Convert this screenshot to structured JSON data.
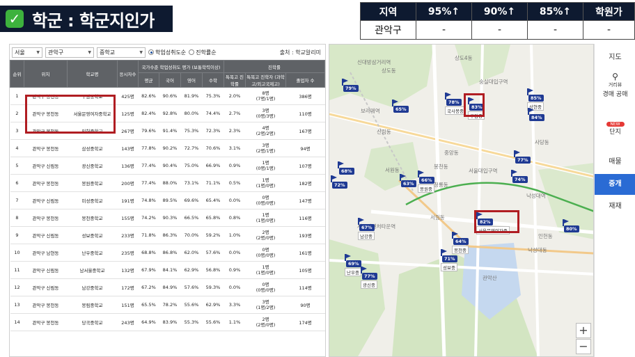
{
  "header": {
    "check_icon": "✓",
    "title": "학군 : 학군지인가"
  },
  "stats": {
    "headers": [
      "지역",
      "95%↑",
      "90%↑",
      "85%↑",
      "학원가"
    ],
    "row": [
      "관악구",
      "-",
      "-",
      "-",
      "-"
    ]
  },
  "filters": {
    "city": "서울",
    "district": "관악구",
    "school_type": "중학교",
    "radio_1": "학업성취도순",
    "radio_2": "진학률순",
    "source": "출처 : 학교알리미"
  },
  "table": {
    "head_top": [
      "순위",
      "위치",
      "학교명",
      "응시자수",
      "국가수준 학업성취도 평가 (보통학력이상)",
      "진학률"
    ],
    "head_sub": [
      "평균",
      "국어",
      "영어",
      "수학",
      "특목고 진학률",
      "특목고 진학자 (과학고/외고국제고)",
      "졸업자 수"
    ],
    "rows": [
      [
        "1",
        "관악구 봉천동",
        "구암중학교",
        "425명",
        "82.6%",
        "90.6%",
        "81.9%",
        "75.3%",
        "2.0%",
        "8명",
        "(7명/1명)",
        "386명"
      ],
      [
        "2",
        "관악구 봉천동",
        "서울문영여자중학교",
        "125명",
        "82.4%",
        "92.8%",
        "80.0%",
        "74.4%",
        "2.7%",
        "3명",
        "(0명/3명)",
        "110명"
      ],
      [
        "3",
        "관악구 봉천동",
        "인헌중학교",
        "267명",
        "79.6%",
        "91.4%",
        "75.3%",
        "72.3%",
        "2.3%",
        "4명",
        "(2명/2명)",
        "167명"
      ],
      [
        "4",
        "관악구 봉천동",
        "삼성중학교",
        "143명",
        "77.8%",
        "90.2%",
        "72.7%",
        "70.6%",
        "3.1%",
        "3명",
        "(2명/1명)",
        "94명"
      ],
      [
        "5",
        "관악구 신림동",
        "광신중학교",
        "136명",
        "77.4%",
        "90.4%",
        "75.0%",
        "66.9%",
        "0.9%",
        "1명",
        "(0명/1명)",
        "107명"
      ],
      [
        "6",
        "관악구 봉천동",
        "봉원중학교",
        "200명",
        "77.4%",
        "88.0%",
        "73.1%",
        "71.1%",
        "0.5%",
        "1명",
        "(1명/0명)",
        "182명"
      ],
      [
        "7",
        "관악구 신림동",
        "미성중학교",
        "191명",
        "74.8%",
        "89.5%",
        "69.6%",
        "65.4%",
        "0.0%",
        "0명",
        "(0명/0명)",
        "147명"
      ],
      [
        "8",
        "관악구 봉천동",
        "봉천중학교",
        "155명",
        "74.2%",
        "90.3%",
        "66.5%",
        "65.8%",
        "0.8%",
        "1명",
        "(1명/0명)",
        "116명"
      ],
      [
        "9",
        "관악구 신림동",
        "성보중학교",
        "233명",
        "71.8%",
        "86.3%",
        "70.0%",
        "59.2%",
        "1.0%",
        "2명",
        "(2명/0명)",
        "193명"
      ],
      [
        "10",
        "관악구 남현동",
        "난우중학교",
        "235명",
        "68.8%",
        "86.8%",
        "62.0%",
        "57.6%",
        "0.0%",
        "0명",
        "(0명/0명)",
        "161명"
      ],
      [
        "11",
        "관악구 신림동",
        "남서울중학교",
        "132명",
        "67.9%",
        "84.1%",
        "62.9%",
        "56.8%",
        "0.9%",
        "1명",
        "(1명/0명)",
        "105명"
      ],
      [
        "12",
        "관악구 신림동",
        "남강중학교",
        "172명",
        "67.2%",
        "84.9%",
        "57.6%",
        "59.3%",
        "0.0%",
        "0명",
        "(0명/0명)",
        "114명"
      ],
      [
        "13",
        "관악구 봉천동",
        "봉림중학교",
        "151명",
        "65.5%",
        "78.2%",
        "55.6%",
        "62.9%",
        "3.3%",
        "3명",
        "(1명/2명)",
        "90명"
      ],
      [
        "14",
        "관악구 봉천동",
        "당곡중학교",
        "243명",
        "64.9%",
        "83.9%",
        "55.3%",
        "55.6%",
        "1.1%",
        "2명",
        "(2명/0명)",
        "174명"
      ]
    ]
  },
  "map": {
    "places": [
      "상도동",
      "신대방삼거리역",
      "보라매역",
      "숭실대입구역",
      "상도4동",
      "사당동",
      "신림동",
      "서원동",
      "봉천동",
      "서울대입구역",
      "청림동",
      "낙성대역",
      "서림동",
      "서울대벤처타운역",
      "관악산",
      "인헌동",
      "낙성대동",
      "중앙동",
      "청룡동"
    ],
    "markers": [
      {
        "pct": "79%",
        "name": ""
      },
      {
        "pct": "65%",
        "name": ""
      },
      {
        "pct": "78%",
        "name": "국사봉중"
      },
      {
        "pct": "83%",
        "name": "구암중"
      },
      {
        "pct": "85%",
        "name": "상현중"
      },
      {
        "pct": "84%",
        "name": ""
      },
      {
        "pct": "77%",
        "name": ""
      },
      {
        "pct": "68%",
        "name": ""
      },
      {
        "pct": "72%",
        "name": ""
      },
      {
        "pct": "63%",
        "name": ""
      },
      {
        "pct": "66%",
        "name": "봉원중"
      },
      {
        "pct": "74%",
        "name": ""
      },
      {
        "pct": "82%",
        "name": "서울문영여자중"
      },
      {
        "pct": "67%",
        "name": "남강중"
      },
      {
        "pct": "64%",
        "name": "봉천중"
      },
      {
        "pct": "80%",
        "name": ""
      },
      {
        "pct": "69%",
        "name": "난우중"
      },
      {
        "pct": "71%",
        "name": "성보중"
      },
      {
        "pct": "77%",
        "name": "광신중"
      }
    ],
    "map_labels": {
      "top": "지도",
      "street": "거리뷰",
      "area": "경매 공매",
      "realty": "단지",
      "new": "NEW",
      "sale": "매물",
      "active": "중개",
      "rent": "재재"
    },
    "zoom_in": "+",
    "zoom_out": "−"
  }
}
